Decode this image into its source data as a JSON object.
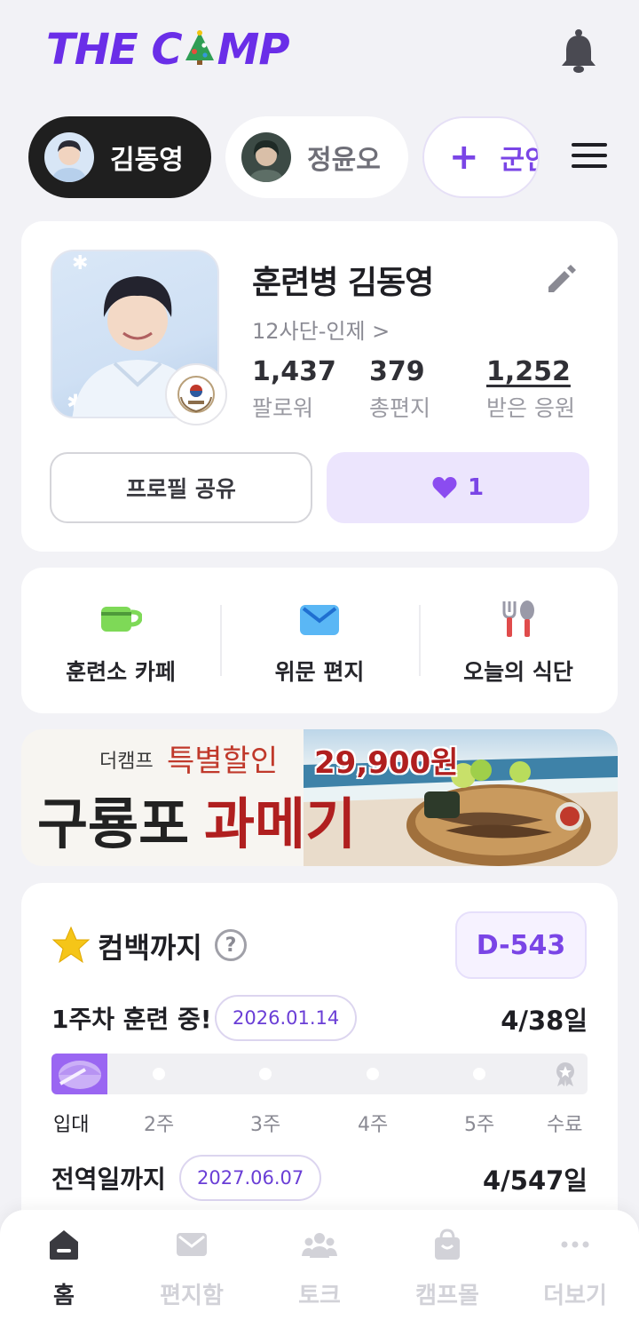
{
  "header": {
    "logo_text_1": "THE C",
    "logo_text_2": "MP"
  },
  "profiles": [
    {
      "name": "김동영",
      "active": true
    },
    {
      "name": "정윤오",
      "active": false
    }
  ],
  "add_profile": {
    "label": "군인",
    "plus": "+"
  },
  "profile_card": {
    "title": "훈련병 김동영",
    "unit": "12사단-인제",
    "unit_chevron": ">",
    "stats": [
      {
        "value": "1,437",
        "label": "팔로워"
      },
      {
        "value": "379",
        "label": "총편지"
      },
      {
        "value": "1,252",
        "label": "받은 응원"
      }
    ],
    "share_label": "프로필 공유",
    "like_count": "1"
  },
  "quick_menu": [
    {
      "label": "훈련소 카페",
      "icon": "cup-icon"
    },
    {
      "label": "위문 편지",
      "icon": "envelope-icon"
    },
    {
      "label": "오늘의 식단",
      "icon": "utensils-icon"
    }
  ],
  "banner": {
    "small_text": "더캠프",
    "highlight": "특별할인",
    "title_black": "구룡포",
    "title_red": "과메기",
    "price": "29,900원"
  },
  "comeback": {
    "title": "컴백까지",
    "help": "?",
    "dday": "D-543",
    "training_label": "1주차 훈련 중!",
    "training_date": "2026.01.14",
    "training_progress": "4/38일",
    "training_fraction": 0.105,
    "ticks": [
      "입대",
      "2주",
      "3주",
      "4주",
      "5주",
      "수료"
    ],
    "discharge_label": "전역일까지",
    "discharge_date": "2027.06.07",
    "discharge_progress": "4/547일"
  },
  "tabbar": [
    {
      "label": "홈",
      "icon": "home-icon",
      "active": true
    },
    {
      "label": "편지함",
      "icon": "mail-icon",
      "active": false
    },
    {
      "label": "토크",
      "icon": "people-icon",
      "active": false
    },
    {
      "label": "캠프몰",
      "icon": "shopping-bag-icon",
      "active": false
    },
    {
      "label": "더보기",
      "icon": "more-icon",
      "active": false
    }
  ],
  "colors": {
    "brand": "#6a2ee8",
    "accent": "#7a45e6",
    "progress": "#9a66f2"
  }
}
